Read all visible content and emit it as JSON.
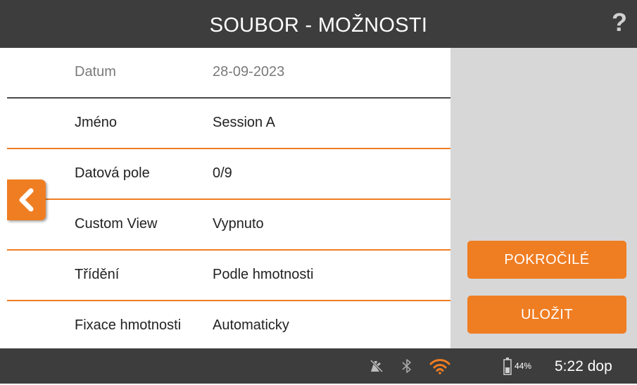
{
  "header": {
    "title": "SOUBOR - MOŽNOSTI",
    "help_label": "?"
  },
  "rows": [
    {
      "label": "Datum",
      "value": "28-09-2023"
    },
    {
      "label": "Jméno",
      "value": "Session A"
    },
    {
      "label": "Datová pole",
      "value": "0/9"
    },
    {
      "label": "Custom View",
      "value": "Vypnuto"
    },
    {
      "label": "Třídění",
      "value": "Podle hmotnosti"
    },
    {
      "label": "Fixace hmotnosti",
      "value": "Automaticky"
    }
  ],
  "actions": {
    "advanced_label": "POKROČILÉ",
    "save_label": "ULOŽIT"
  },
  "status": {
    "battery_percent": "44%",
    "time": "5:22 dop",
    "icons": [
      "no-print-icon",
      "bluetooth-icon",
      "wifi-icon",
      "battery-icon"
    ]
  },
  "colors": {
    "accent": "#ef7d22",
    "bar": "#3d3d3d",
    "panel": "#d7d7d7"
  }
}
